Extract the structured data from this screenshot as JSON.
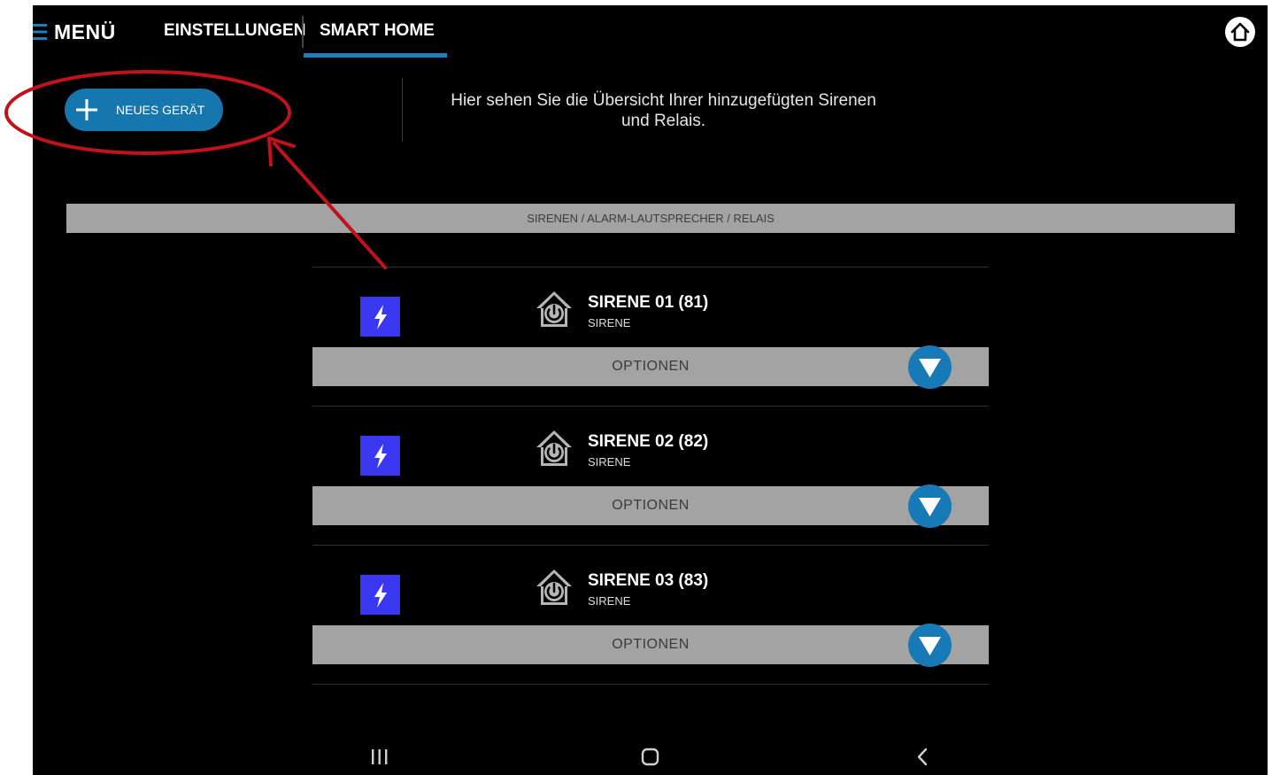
{
  "nav": {
    "menu_label": "MENÜ",
    "tabs": [
      {
        "label": "EINSTELLUNGEN",
        "active": false
      },
      {
        "label": "SMART HOME",
        "active": true
      }
    ],
    "accent_color": "#1c7fbd"
  },
  "toolbar": {
    "new_device_label": "NEUES GERÄT"
  },
  "info": {
    "line1": "Hier sehen Sie die Übersicht Ihrer hinzugefügten Sirenen",
    "line2": "und Relais."
  },
  "section": {
    "title": "SIRENEN / ALARM-LAUTSPRECHER / RELAIS"
  },
  "devices": [
    {
      "name": "SIRENE 01 (81)",
      "type": "SIRENE",
      "options_label": "OPTIONEN",
      "icon": "lightning-icon"
    },
    {
      "name": "SIRENE 02 (82)",
      "type": "SIRENE",
      "options_label": "OPTIONEN",
      "icon": "lightning-icon"
    },
    {
      "name": "SIRENE 03 (83)",
      "type": "SIRENE",
      "options_label": "OPTIONEN",
      "icon": "lightning-icon"
    }
  ],
  "system_nav": {
    "icons": [
      "recent-apps-icon",
      "home-circle-icon",
      "back-icon"
    ]
  },
  "annotation": {
    "color": "#c0121b"
  }
}
